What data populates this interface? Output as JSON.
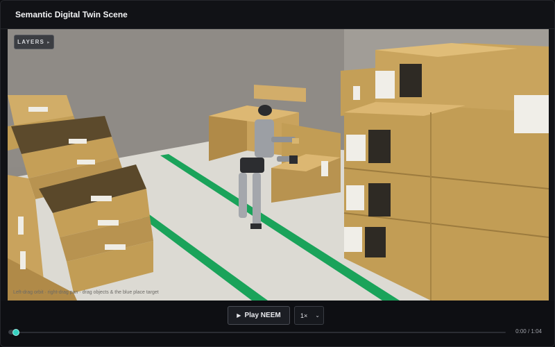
{
  "window": {
    "title": "Semantic Digital Twin Scene"
  },
  "viewport": {
    "layers_label": "LAYERS",
    "hint": "Left-drag orbit · right-drag pan · drag objects & the blue place target"
  },
  "controls": {
    "play_label": "Play NEEM",
    "speed_value": "1×",
    "time_current": "0:00",
    "time_total": "1:04",
    "progress": 0.0
  },
  "colors": {
    "accent": "#2bbfb2",
    "floor_stripe": "#1aa35a",
    "box": "#c29d55",
    "background": "#0b0c0f"
  },
  "icons": [
    "play-icon",
    "chevron-right-icon",
    "chevron-down-icon"
  ]
}
